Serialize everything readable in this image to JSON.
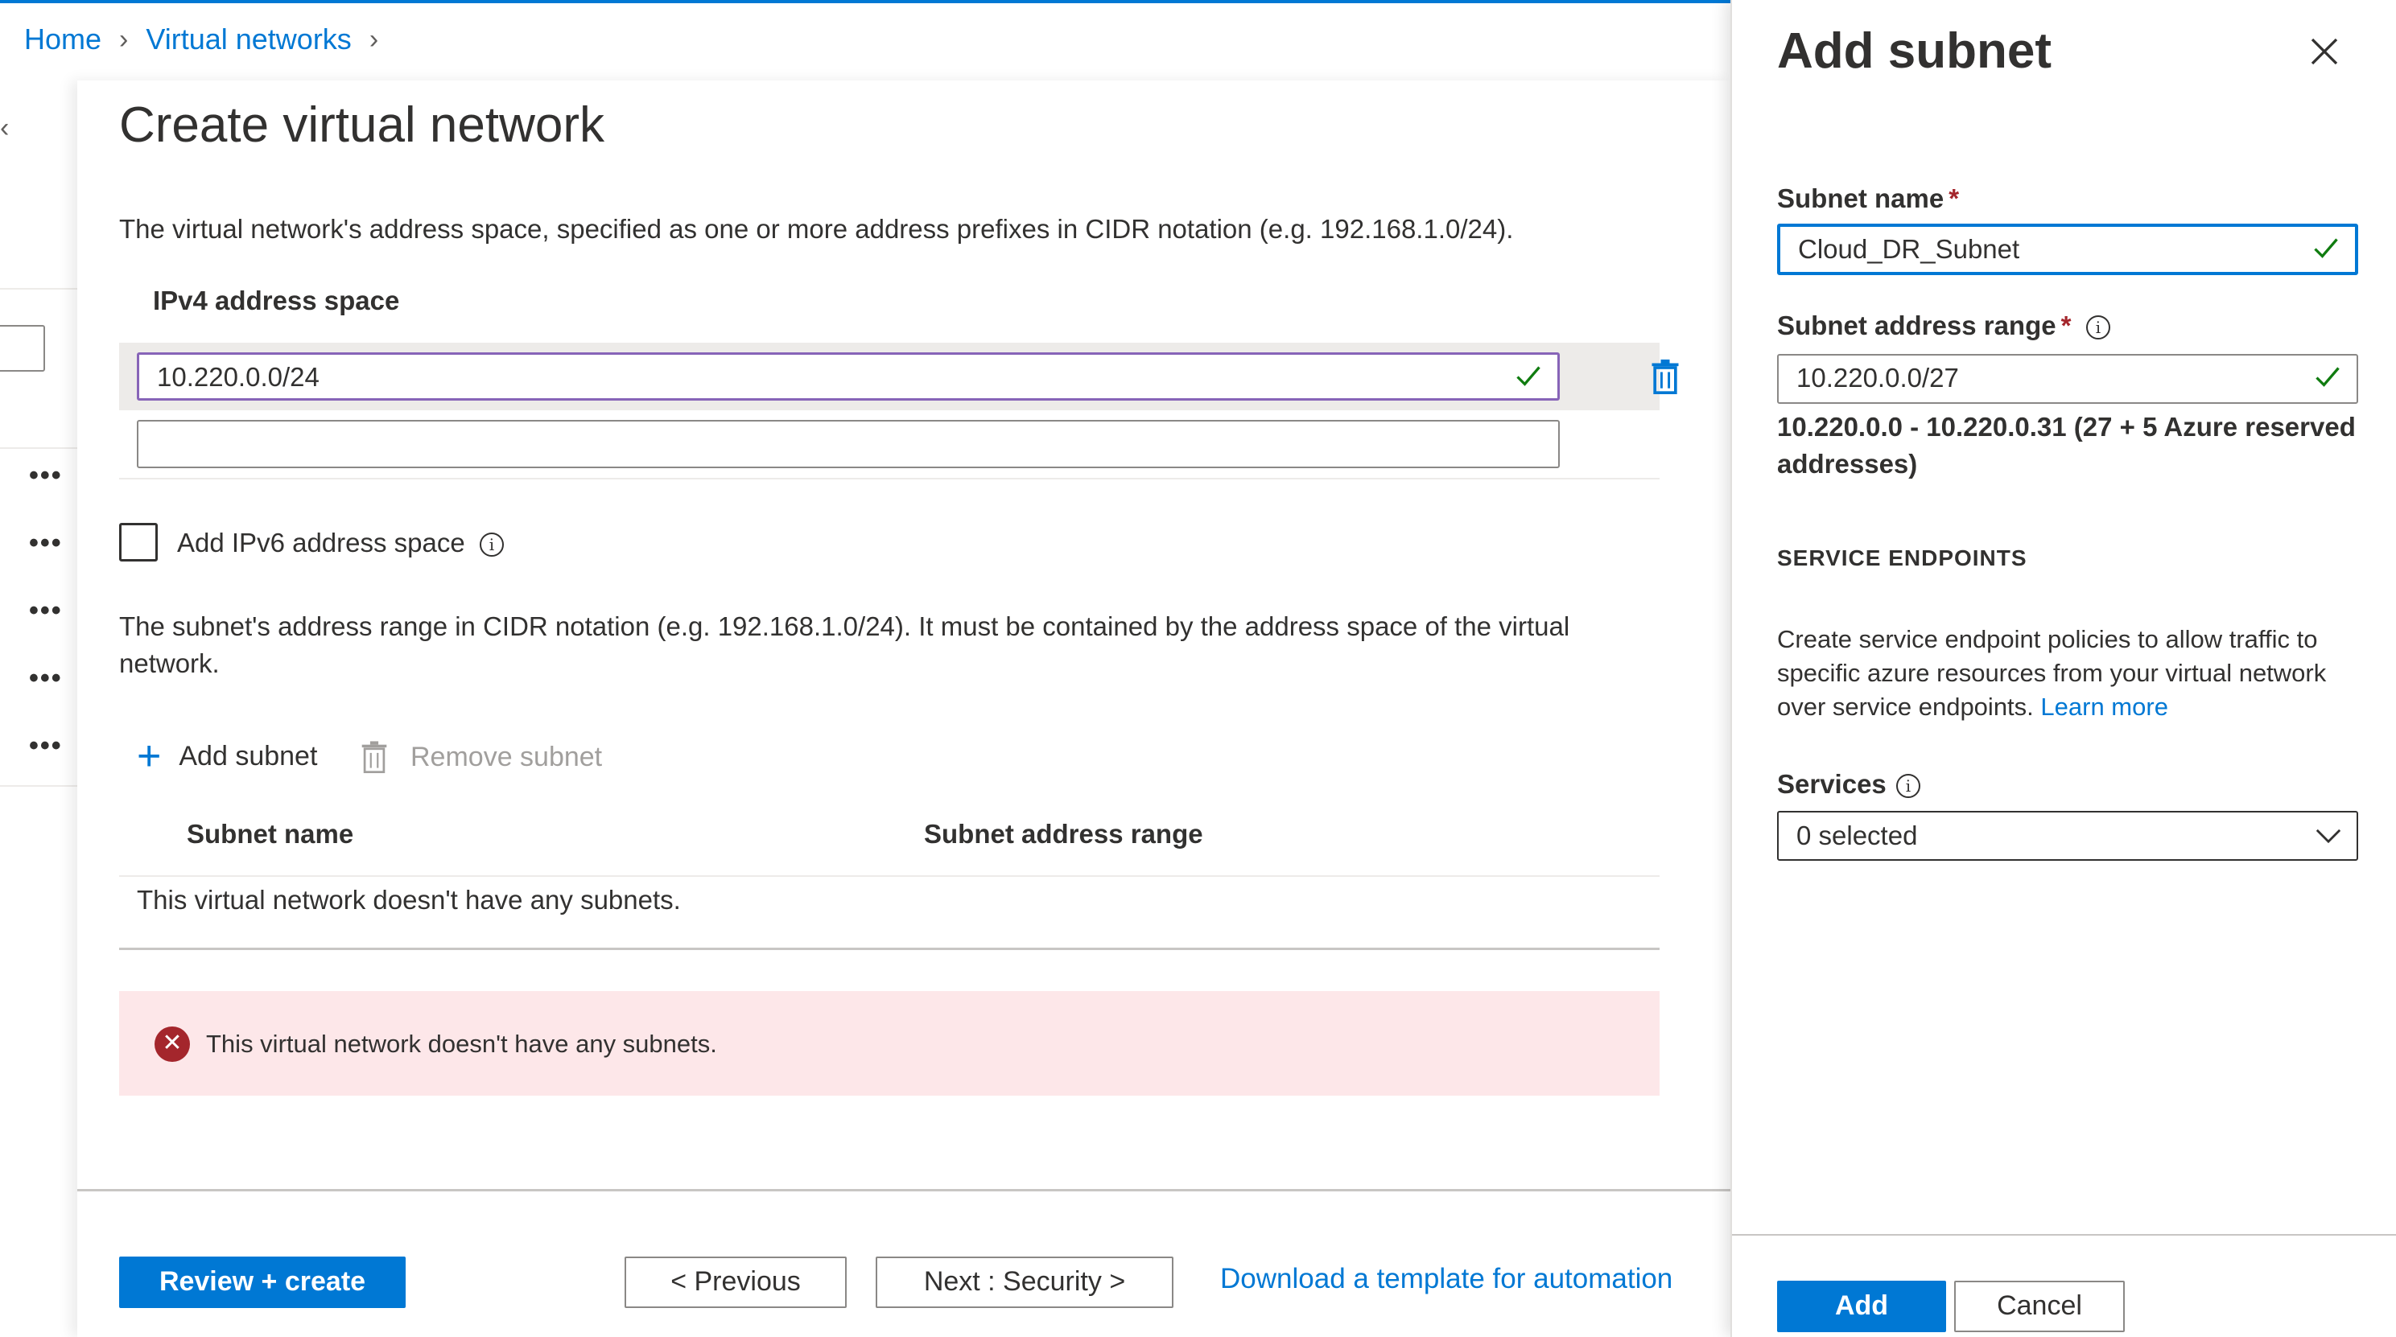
{
  "breadcrumb": {
    "home": "Home",
    "virtual_networks": "Virtual networks"
  },
  "main": {
    "title": "Create virtual network",
    "address_space_desc": "The virtual network's address space, specified as one or more address prefixes in CIDR notation (e.g. 192.168.1.0/24).",
    "ipv4_label": "IPv4 address space",
    "ipv4_value": "10.220.0.0/24",
    "ipv4_empty_value": "",
    "ipv6_checkbox_label": "Add IPv6 address space",
    "ipv6_checked": false,
    "subnet_desc": "The subnet's address range in CIDR notation (e.g. 192.168.1.0/24). It must be contained by the address space of the virtual network.",
    "add_subnet": "Add subnet",
    "remove_subnet": "Remove subnet",
    "columns": {
      "name": "Subnet name",
      "range": "Subnet address range"
    },
    "empty_message": "This virtual network doesn't have any subnets.",
    "error_message": "This virtual network doesn't have any subnets.",
    "footer": {
      "review_create": "Review + create",
      "previous": "< Previous",
      "next": "Next : Security >",
      "download": "Download a template for automation"
    }
  },
  "panel": {
    "title": "Add subnet",
    "subnet_name_label": "Subnet name",
    "subnet_name_value": "Cloud_DR_Subnet",
    "subnet_range_label": "Subnet address range",
    "subnet_range_value": "10.220.0.0/27",
    "range_note": "10.220.0.0 - 10.220.0.31 (27 + 5 Azure reserved addresses)",
    "service_endpoints_heading": "SERVICE ENDPOINTS",
    "service_endpoints_desc": "Create service endpoint policies to allow traffic to specific azure resources from your virtual network over service endpoints.",
    "learn_more": "Learn more",
    "services_label": "Services",
    "services_value": "0 selected",
    "add_button": "Add",
    "cancel_button": "Cancel",
    "required_mark": "*"
  },
  "colors": {
    "accent": "#0078d4",
    "error": "#a4262c",
    "error_bg": "#fde7e9",
    "success": "#107c10",
    "focus_purple": "#8764b8"
  },
  "icons": [
    "chevron-right-icon",
    "checkmark-icon",
    "trash-icon",
    "info-icon",
    "plus-icon",
    "error-icon",
    "close-icon",
    "chevron-down-icon",
    "more-icon"
  ]
}
